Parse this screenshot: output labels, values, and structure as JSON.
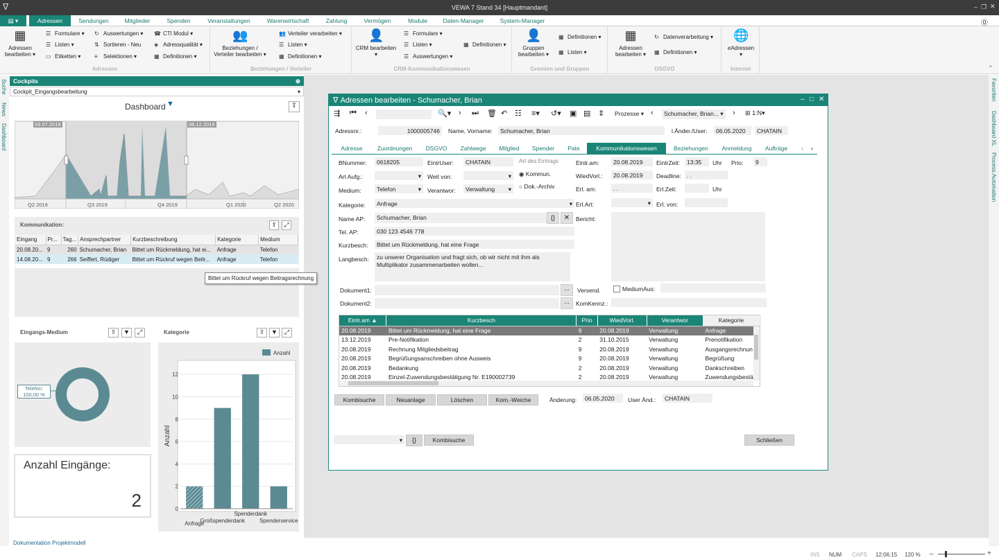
{
  "window_title": "VEWA 7 Stand 34 [Hauptmandant]",
  "menu": [
    "Adressen",
    "Sendungen",
    "Mitglieder",
    "Spenden",
    "Veranstaltungen",
    "Warenwirtschaft",
    "Zahlung",
    "Vermögen",
    "Module",
    "Daten-Manager",
    "System-Manager"
  ],
  "ribbon": {
    "adressen": {
      "big": "Adressen bearbeiten",
      "items": [
        "Formulare",
        "Listen",
        "Etiketten",
        "Auswertungen",
        "Sortieren - Neu",
        "Selektionen",
        "CTI Modul",
        "Adressqualität",
        "Definitionen"
      ],
      "label": "Adressen"
    },
    "bez": {
      "big": "Beziehungen / Verteiler bearbeiten",
      "items": [
        "Verteiler verarbeiten",
        "Listen",
        "Definitionen"
      ],
      "label": "Beziehungen / Verteiler"
    },
    "crm": {
      "big": "CRM bearbeiten",
      "items": [
        "Formulare",
        "Listen",
        "Auswertungen",
        "Definitionen"
      ],
      "label": "CRM-Kommunikationswesen"
    },
    "gremien": {
      "big": "Gruppen bearbeiten",
      "items": [
        "Definitionen",
        "Listen"
      ],
      "label": "Gremien und Gruppen"
    },
    "dsgvo": {
      "big": "Adressen bearbeiten",
      "items": [
        "Datenverarbeitung",
        "Definitionen"
      ],
      "label": "DSGVO"
    },
    "internet": {
      "big": "eAdressen",
      "label": "Internet"
    }
  },
  "side_left": [
    "Suche",
    "News",
    "Dashboard"
  ],
  "side_right": [
    "Favoriten",
    "Dashboard XL",
    "Process Automation"
  ],
  "cockpit": {
    "title": "Cockpits",
    "selected": "Cockpit_Eingangsbearbeitung",
    "dashboard_title": "Dashboard",
    "range_start": "03.07.2019",
    "range_end": "08.12.2019",
    "quarters": [
      "Q2 2019",
      "Q3 2019",
      "Q4 2019",
      "Q1 2020",
      "Q2 2020"
    ],
    "komm_title": "Kommunikation:",
    "komm_headers": [
      "Eingang",
      "Pr...",
      "Tag...",
      "Ansprechpartner",
      "Kurzbeschreibung",
      "Kategorie",
      "Medium"
    ],
    "komm_rows": [
      [
        "20.08.20...",
        "9",
        "260",
        "Schumacher, Brian",
        "Bittet um Rückmeldung, hat ei...",
        "Anfrage",
        "Telefon"
      ],
      [
        "14.08.20...",
        "9",
        "266",
        "Seiffert, Rüdiger",
        "Bittet um Rückruf wegen Beitr...",
        "Anfrage",
        "Telefon"
      ]
    ],
    "tooltip": "Bittet um Rückruf wegen Beitragsrechnung",
    "medium_title": "Eingangs-Medium",
    "medium_label": "Telefon:\n100,00 %",
    "kategorie_title": "Kategorie",
    "anzahl_title": "Anzahl Eingänge:",
    "anzahl_value": "2",
    "footer_link": "Dokumentation Projektmodell"
  },
  "chart_data": {
    "type": "bar",
    "categories": [
      "Anfrage",
      "Großspenderdank",
      "Spenderdank",
      "Spenderservice"
    ],
    "values": [
      2,
      9,
      12,
      2
    ],
    "legend": "Anzahl",
    "ylabel": "Anzahl",
    "ylim": [
      0,
      13
    ],
    "yticks": [
      0,
      2,
      4,
      6,
      8,
      10,
      12
    ],
    "color": "#5b8a93",
    "legend_position": "top-right"
  },
  "dialog": {
    "title": "Adressen bearbeiten - Schumacher, Brian",
    "toolbar_process": "Prozesse",
    "toolbar_name": "Schumacher, Brian...",
    "toolbar_rel": "1:N",
    "adressnr_label": "Adressnr.:",
    "adressnr": "1000005746",
    "name_label": "Name, Vorname:",
    "name": "Schumacher, Brian",
    "laender_label": "l.Änder./User:",
    "laender_date": "06.05.2020",
    "laender_user": "CHATAIN",
    "tabs": [
      "Adresse",
      "Zuordnungen",
      "DSGVO",
      "Zahlwege",
      "Mitglied",
      "Spender",
      "Pate",
      "Kommunikationswesen",
      "Beziehungen",
      "Anmeldung",
      "Aufträge"
    ],
    "bnummer_label": "BNummer:",
    "bnummer": "0618205",
    "eintruser_label": "EintrUser:",
    "eintruser": "CHATAIN",
    "art_eintrag": "Art des Eintrags",
    "kommun": "Kommun.",
    "dokarchiv": "Dok.-Archiv",
    "eintr_am_label": "Eintr.am:",
    "eintr_am": "20.08.2019",
    "eintrzeit_label": "EintrZeit:",
    "eintrzeit": "13:35",
    "uhr": "Uhr",
    "prio_label": "Prio:",
    "prio": "9",
    "artaufg_label": "Art Aufg.:",
    "weitvon_label": "Weit von:",
    "wiedvorl_label": "WiedVorl.:",
    "wiedvorl": "20.08.2019",
    "deadline_label": "Deadline:",
    "deadline": ". .",
    "medium_label": "Medium:",
    "medium": "Telefon",
    "verantwor_label": "Verantwor:",
    "verantwor": "Verwaltung",
    "erl_am_label": "Erl. am:",
    "erl_am": ". .",
    "erl_zeit_label": "Erl.Zeit:",
    "erl_uhr": "Uhr",
    "kategorie_label": "Kategorie:",
    "kategorie": "Anfrage",
    "erl_art_label": "Erl.Art:",
    "erl_von_label": "Erl. von:",
    "name_ap_label": "Name AP:",
    "name_ap": "Schumacher, Brian",
    "bericht_label": "Bericht:",
    "tel_ap_label": "Tel. AP:",
    "tel_ap": "030 123 4546 778",
    "kurzbesch_label": "Kurzbesch:",
    "kurzbesch": "Bittet um Rückmeldung, hat eine Frage",
    "langbesch_label": "Langbesch:",
    "langbesch": "zu unserer Organisation und fragt sich, ob wir nicht mit ihm als Multiplikator zusammenarbeiten wollen...",
    "dok1_label": "Dokument1:",
    "dok2_label": "Dokument2:",
    "versend_label": "Versend.",
    "mediumaus_label": "MediumAus:",
    "komkennz_label": "KomKennz.:",
    "grid_headers": [
      "Eintr.am",
      "Kurzbesch",
      "Prio",
      "WiedVorl.",
      "Verantwor",
      "Kategorie"
    ],
    "grid_rows": [
      [
        "20.08.2019",
        "Bittet um Rückmeldung, hat eine Frage",
        "9",
        "20.08.2019",
        "Verwaltung",
        "Anfrage"
      ],
      [
        "13.12.2019",
        "Pre-Notifikation",
        "2",
        "31.10.2015",
        "Verwaltung",
        "Prenotifikation"
      ],
      [
        "20.08.2019",
        "Rechnung Mitgliedsbeitrag",
        "9",
        "20.08.2019",
        "Verwaltung",
        "Ausgangsrechnun"
      ],
      [
        "20.08.2019",
        "Begrüßungsanschreiben ohne Ausweis",
        "9",
        "20.08.2019",
        "Verwaltung",
        "Begrüßung"
      ],
      [
        "20.08.2019",
        "Bedankung",
        "2",
        "20.08.2019",
        "Verwaltung",
        "Dankschreiben"
      ],
      [
        "20.08.2019",
        "Einzel-Zuwendungsbestätigung Nr. E190002739",
        "2",
        "20.08.2019",
        "Verwaltung",
        "Zuwendungsbestä"
      ]
    ],
    "btn_kombisuche": "Kombisuche",
    "btn_neuanlage": "Neuanlage",
    "btn_loeschen": "Löschen",
    "btn_komweiche": "Kom.-Weiche",
    "aenderung_label": "Änderung:",
    "aenderung": "06.05.2020",
    "userand_label": "User Änd.:",
    "userand": "CHATAIN",
    "btn_kombisuche2": "Kombisuche",
    "btn_schliessen": "Schließen"
  },
  "status": {
    "ins": "INS",
    "num": "NUM",
    "caps": "CAPS",
    "time": "12:06:15",
    "zoom": "120 %"
  }
}
